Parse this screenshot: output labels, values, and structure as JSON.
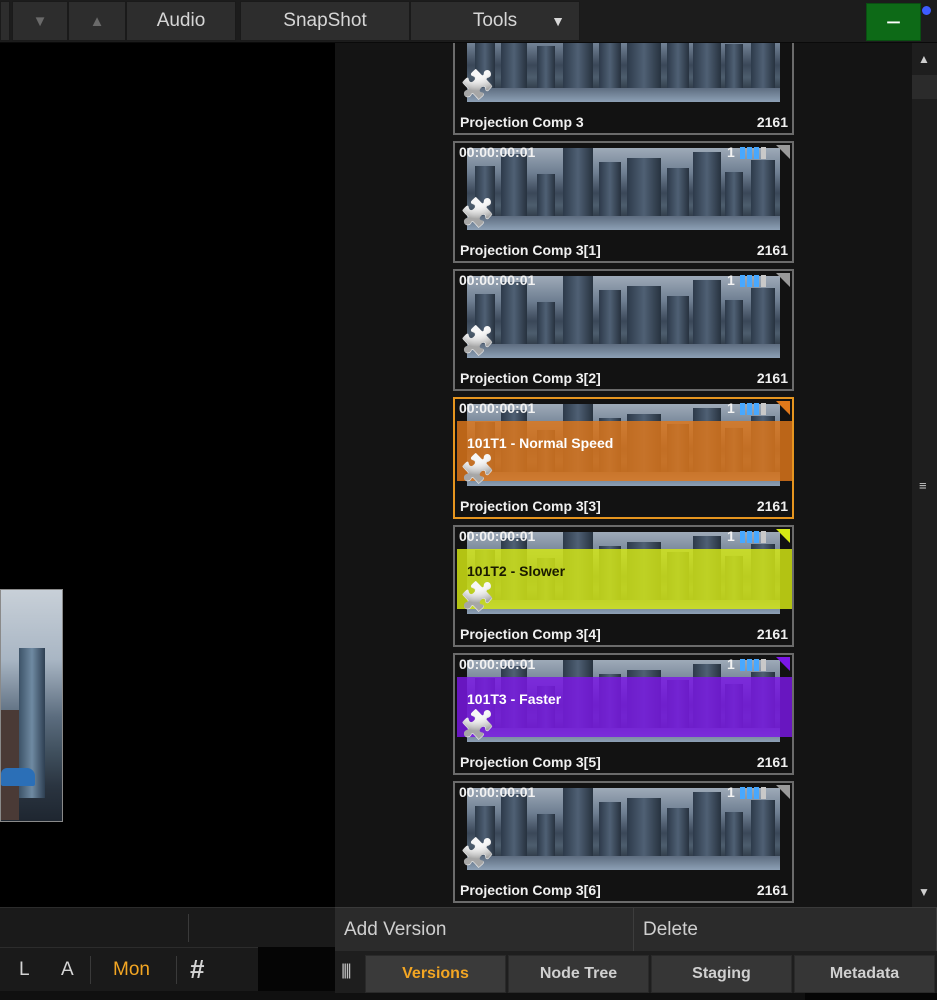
{
  "toolbar": {
    "down_arrow": "▼",
    "up_arrow": "▲",
    "audio": "Audio",
    "snapshot": "SnapShot",
    "tools": "Tools",
    "tools_caret": "▼",
    "minimize": "−"
  },
  "versions": [
    {
      "timecode": "",
      "version": "",
      "name": "Projection Comp 3",
      "frames": "2161",
      "tag": null,
      "tag_color": null,
      "flag_color": null,
      "active": false
    },
    {
      "timecode": "00:00:00:01",
      "version": "1",
      "name": "Projection Comp 3[1]",
      "frames": "2161",
      "tag": null,
      "tag_color": null,
      "flag_color": "#9a9a9a",
      "active": false
    },
    {
      "timecode": "00:00:00:01",
      "version": "1",
      "name": "Projection Comp 3[2]",
      "frames": "2161",
      "tag": null,
      "tag_color": null,
      "flag_color": "#9a9a9a",
      "active": false
    },
    {
      "timecode": "00:00:00:01",
      "version": "1",
      "name": "Projection Comp 3[3]",
      "frames": "2161",
      "tag": "101T1 - Normal Speed",
      "tag_color": "#e0781a",
      "flag_color": "#e0781a",
      "active": true
    },
    {
      "timecode": "00:00:00:01",
      "version": "1",
      "name": "Projection Comp 3[4]",
      "frames": "2161",
      "tag": "101T2 - Slower",
      "tag_color": "#d7ea14",
      "flag_color": "#d7ea14",
      "active": false
    },
    {
      "timecode": "00:00:00:01",
      "version": "1",
      "name": "Projection Comp 3[5]",
      "frames": "2161",
      "tag": "101T3 - Faster",
      "tag_color": "#7b17e6",
      "flag_color": "#7b17e6",
      "active": false
    },
    {
      "timecode": "00:00:00:01",
      "version": "1",
      "name": "Projection Comp 3[6]",
      "frames": "2161",
      "tag": null,
      "tag_color": null,
      "flag_color": "#9a9a9a",
      "active": false
    }
  ],
  "transport": {
    "l": "L",
    "a": "A",
    "mon": "Mon",
    "grid": "#"
  },
  "actions": {
    "add_version": "Add Version",
    "delete": "Delete"
  },
  "tabs": {
    "grip": "||||",
    "versions": "Versions",
    "node_tree": "Node Tree",
    "staging": "Staging",
    "metadata": "Metadata"
  },
  "scrollbar": {
    "up": "▲",
    "down": "▼",
    "grip": "≡"
  },
  "colors": {
    "accent": "#f3a623",
    "minimize_bg": "#0d6a17",
    "bar_blue": "#48a8ff"
  }
}
